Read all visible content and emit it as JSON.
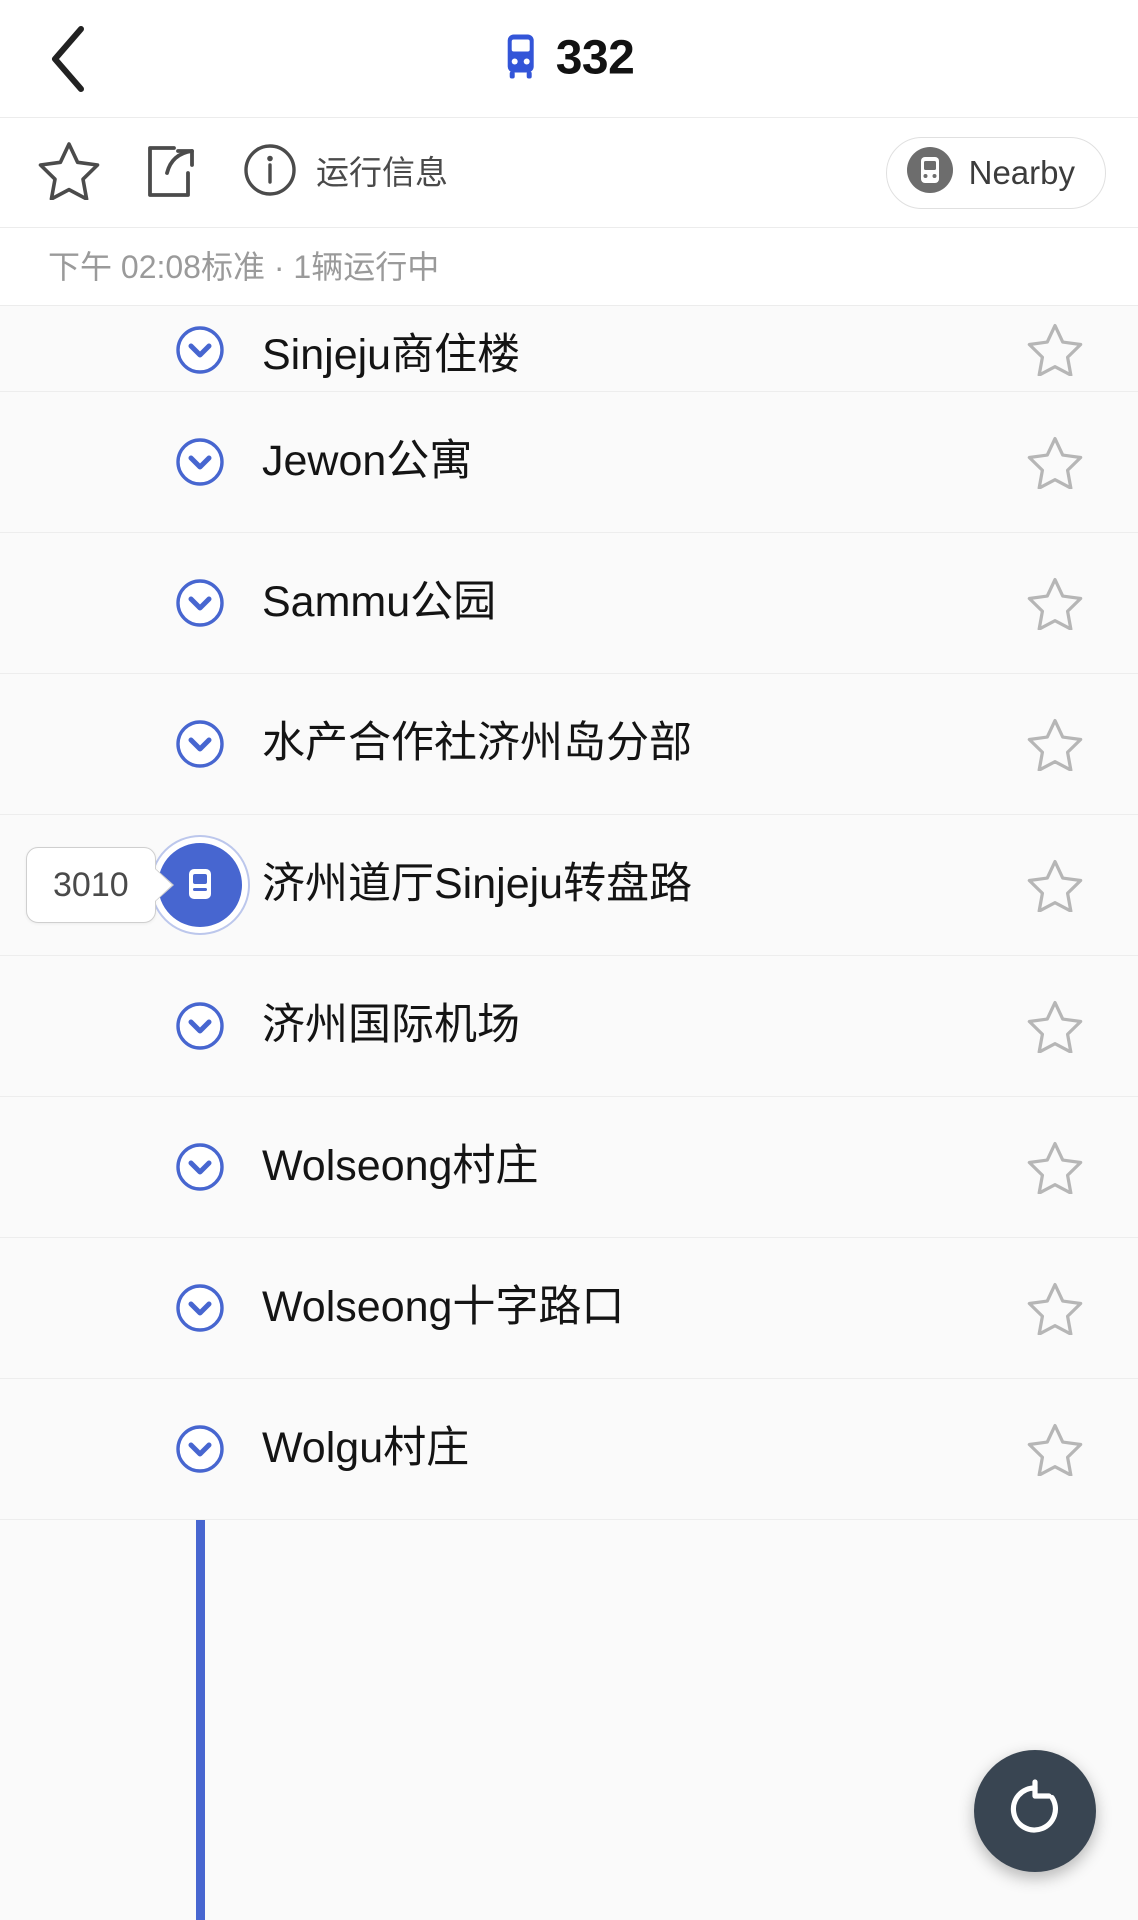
{
  "header": {
    "back_icon": "chevron-left-icon",
    "bus_icon": "bus-icon",
    "route_number": "332"
  },
  "actionbar": {
    "favorite_icon": "star-outline-icon",
    "share_icon": "share-icon",
    "info_icon": "info-circle-icon",
    "info_label": "运行信息",
    "nearby_icon": "bus-stop-icon",
    "nearby_label": "Nearby"
  },
  "status": {
    "text": "下午 02:08标准  ·  1辆运行中"
  },
  "colors": {
    "accent": "#4766d0",
    "fab_background": "#394552",
    "row_background": "#fafafa",
    "status_text": "#9a9a9a"
  },
  "vehicle": {
    "badge_label": "3010",
    "marker_icon": "bus-marker-icon",
    "at_stop_index": 4
  },
  "stops": [
    {
      "name": "Sinjeju商住楼",
      "marker_icon": "chevron-down-circle-icon",
      "star_icon": "star-outline-icon"
    },
    {
      "name": "Jewon公寓",
      "marker_icon": "chevron-down-circle-icon",
      "star_icon": "star-outline-icon"
    },
    {
      "name": "Sammu公园",
      "marker_icon": "chevron-down-circle-icon",
      "star_icon": "star-outline-icon"
    },
    {
      "name": "水产合作社济州岛分部",
      "marker_icon": "chevron-down-circle-icon",
      "star_icon": "star-outline-icon"
    },
    {
      "name": "济州道厅Sinjeju转盘路",
      "marker_icon": "bus-marker-icon",
      "star_icon": "star-outline-icon"
    },
    {
      "name": "济州国际机场",
      "marker_icon": "chevron-down-circle-icon",
      "star_icon": "star-outline-icon"
    },
    {
      "name": "Wolseong村庄",
      "marker_icon": "chevron-down-circle-icon",
      "star_icon": "star-outline-icon"
    },
    {
      "name": "Wolseong十字路口",
      "marker_icon": "chevron-down-circle-icon",
      "star_icon": "star-outline-icon"
    },
    {
      "name": "Wolgu村庄",
      "marker_icon": "chevron-down-circle-icon",
      "star_icon": "star-outline-icon"
    }
  ],
  "fab": {
    "icon": "refresh-icon"
  }
}
